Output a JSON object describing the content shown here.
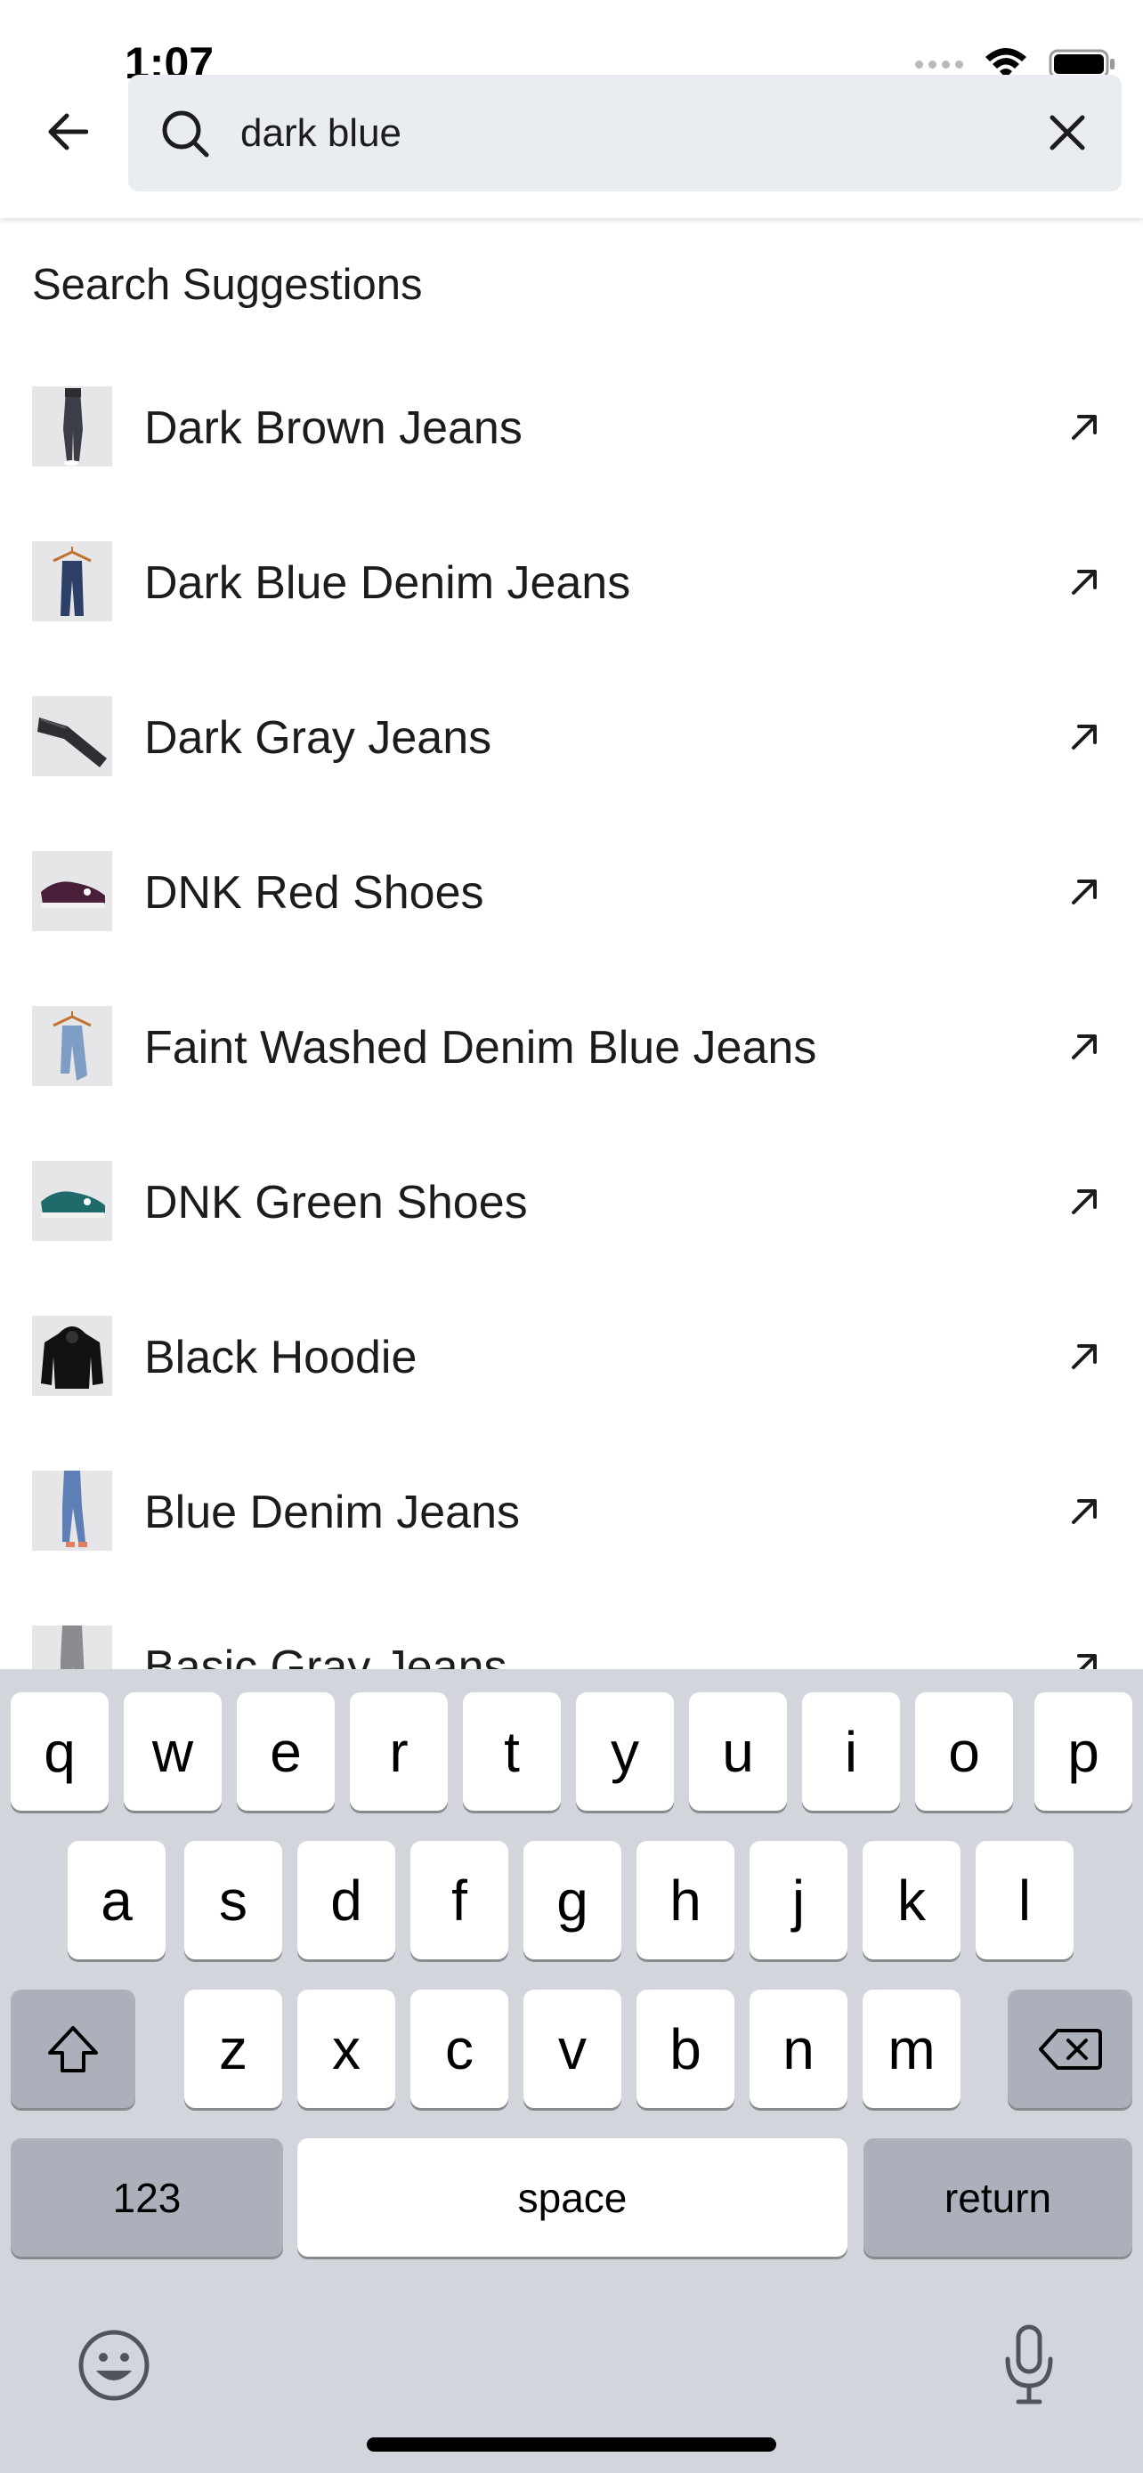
{
  "status_bar": {
    "time": "1:07"
  },
  "search": {
    "query": "dark blue"
  },
  "suggestions": {
    "title": "Search Suggestions",
    "items": [
      {
        "label": "Dark Brown Jeans",
        "thumb": "jeans-legs"
      },
      {
        "label": "Dark Blue Denim Jeans",
        "thumb": "hanger-jeans"
      },
      {
        "label": "Dark Gray Jeans",
        "thumb": "folded-jeans"
      },
      {
        "label": "DNK Red Shoes",
        "thumb": "red-shoe"
      },
      {
        "label": "Faint Washed Denim Blue Jeans",
        "thumb": "hanger-light-jeans"
      },
      {
        "label": "DNK Green Shoes",
        "thumb": "green-shoe"
      },
      {
        "label": "Black Hoodie",
        "thumb": "hoodie"
      },
      {
        "label": "Blue Denim Jeans",
        "thumb": "blue-jeans-legs"
      },
      {
        "label": "Basic Gray Jeans",
        "thumb": "gray-jeans"
      }
    ]
  },
  "keyboard": {
    "row1": [
      "q",
      "w",
      "e",
      "r",
      "t",
      "y",
      "u",
      "i",
      "o",
      "p"
    ],
    "row2": [
      "a",
      "s",
      "d",
      "f",
      "g",
      "h",
      "j",
      "k",
      "l"
    ],
    "row3": [
      "z",
      "x",
      "c",
      "v",
      "b",
      "n",
      "m"
    ],
    "numbers_label": "123",
    "space_label": "space",
    "return_label": "return"
  },
  "colors": {
    "background": "#ffffff",
    "search_field": "#e9ecf0",
    "keyboard_bg": "#d2d5db",
    "key_dark": "#abb0ba",
    "text": "#1c1c1e"
  }
}
